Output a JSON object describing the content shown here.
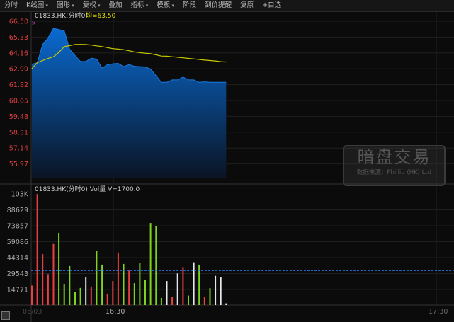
{
  "toolbar": {
    "items": [
      {
        "label": "分时",
        "dd": false
      },
      {
        "label": "K线图",
        "dd": true
      },
      {
        "label": "图形",
        "dd": true
      },
      {
        "label": "复权",
        "dd": true
      },
      {
        "label": "叠加",
        "dd": false
      },
      {
        "label": "指标",
        "dd": true
      },
      {
        "label": "模板",
        "dd": true
      },
      {
        "label": "阶段",
        "dd": false
      },
      {
        "label": "到价提醒",
        "dd": false
      },
      {
        "label": "复原",
        "dd": false
      },
      {
        "label": "+自选",
        "dd": false
      }
    ]
  },
  "price_panel": {
    "symbol_label": "01833.HK(分时0)",
    "avg_label": "均=63.50"
  },
  "volume_panel": {
    "label": "01833.HK(分时0) Vol量 V=1700.0"
  },
  "watermark": {
    "title": "暗盘交易",
    "source": "数据来源：Phillip (HK) Ltd"
  },
  "colors": {
    "up": "#e84040",
    "down": "#7ed321",
    "flat": "#e8e8e8",
    "price_fill": "#0a6ad0",
    "avg_line": "#c8c800",
    "vol_avg_line": "#2a7fff"
  },
  "chart_data": [
    {
      "type": "area",
      "title": "01833.HK(分时0)",
      "ylim": [
        55.97,
        66.5
      ],
      "yticks": [
        "66.50",
        "65.33",
        "64.16",
        "62.99",
        "61.82",
        "60.65",
        "59.48",
        "58.31",
        "57.14",
        "55.97"
      ],
      "xticks": [
        "05/03",
        "16:30",
        "17:30"
      ],
      "price": [
        63.32,
        63.44,
        64.79,
        65.28,
        65.98,
        65.89,
        65.8,
        64.44,
        63.97,
        63.53,
        63.53,
        63.78,
        63.71,
        63.04,
        63.3,
        63.36,
        63.39,
        63.15,
        63.3,
        63.18,
        63.15,
        63.13,
        62.97,
        62.48,
        61.99,
        61.99,
        62.17,
        62.17,
        62.38,
        62.17,
        62.17,
        61.99,
        62.03,
        61.99,
        61.99,
        61.99,
        61.99
      ],
      "average": [
        63.0,
        63.44,
        63.6,
        63.75,
        63.88,
        64.2,
        64.63,
        64.7,
        64.78,
        64.79,
        64.78,
        64.74,
        64.68,
        64.63,
        64.55,
        64.48,
        64.44,
        64.4,
        64.32,
        64.24,
        64.18,
        64.14,
        64.1,
        64.02,
        63.93,
        63.92,
        63.88,
        63.84,
        63.8,
        63.76,
        63.72,
        63.68,
        63.63,
        63.6,
        63.57,
        63.52,
        63.49
      ]
    },
    {
      "type": "bar",
      "title": "Vol量",
      "ylim": [
        0,
        103000
      ],
      "yticks": [
        "103K",
        "88629",
        "73857",
        "59086",
        "44314",
        "29543",
        "14771"
      ],
      "average_volume": 31967,
      "values": [
        18078,
        102955,
        47178,
        28660,
        56659,
        67020,
        19180,
        36156,
        12125,
        15873,
        25794,
        17196,
        50486,
        37479,
        10582,
        22267,
        48722,
        38140,
        31967,
        20283,
        39242,
        23590,
        76060,
        73194,
        6614,
        22267,
        7716,
        29321,
        35274,
        8818,
        39683,
        37479,
        7716,
        15653,
        27117,
        26235,
        1543
      ],
      "direction": [
        "up",
        "up",
        "up",
        "up",
        "up",
        "down",
        "down",
        "down",
        "down",
        "down",
        "flat",
        "up",
        "down",
        "down",
        "up",
        "up",
        "up",
        "down",
        "up",
        "down",
        "down",
        "down",
        "down",
        "down",
        "down",
        "flat",
        "up",
        "flat",
        "up",
        "down",
        "flat",
        "down",
        "up",
        "down",
        "flat",
        "flat",
        "flat"
      ]
    }
  ]
}
